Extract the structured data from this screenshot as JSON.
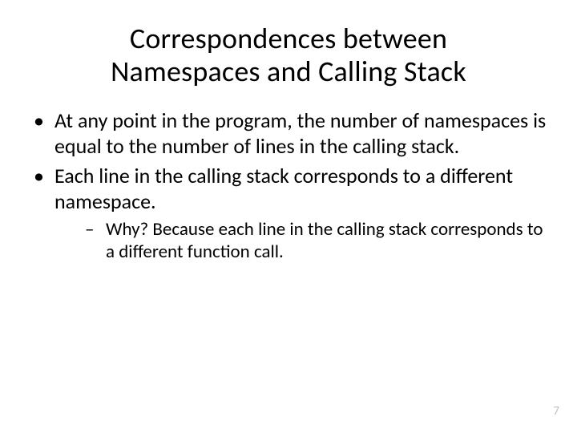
{
  "title_line1": "Correspondences between",
  "title_line2": "Namespaces and Calling Stack",
  "bullets": {
    "b1": "At any point in the program, the number of namespaces is equal to the number of lines in the calling stack.",
    "b2": "Each line in the calling stack corresponds to a different namespace.",
    "b2_sub1": "Why? Because each line in the calling stack corresponds to a different function call."
  },
  "page_number": "7"
}
